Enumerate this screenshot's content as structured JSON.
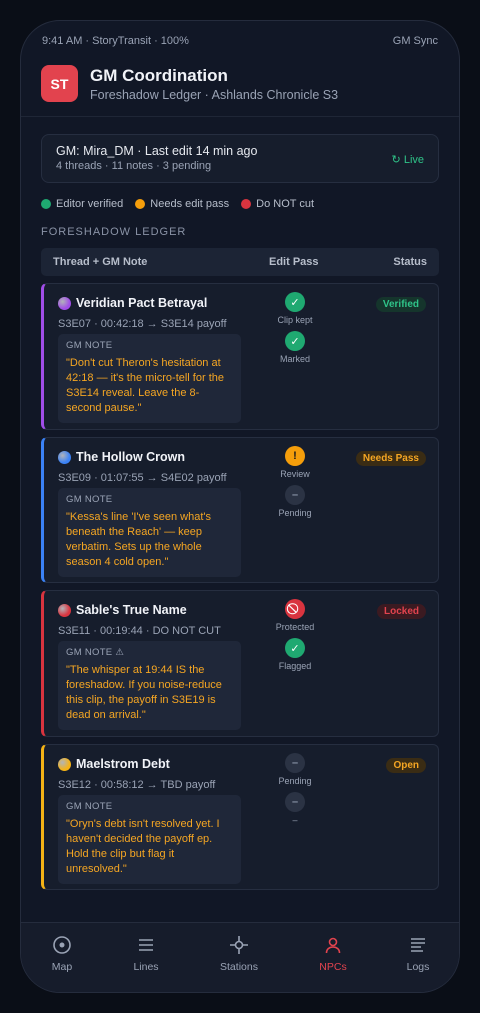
{
  "status_bar": {
    "left": "9:41 AM · StoryTransit · 100%",
    "right": "GM Sync"
  },
  "app": {
    "icon_text": "ST",
    "title": "GM Coordination",
    "subtitle": "Foreshadow Ledger · Ashlands Chronicle S3"
  },
  "gm_card": {
    "line": "GM: Mira_DM · Last edit 14 min ago",
    "counts": "4 threads · 11 notes · 3 pending",
    "live": "↻ Live"
  },
  "legend": [
    {
      "label": "Editor verified",
      "color": "#1fa971"
    },
    {
      "label": "Needs edit pass",
      "color": "#f59e0b"
    },
    {
      "label": "Do NOT cut",
      "color": "#d9343f"
    }
  ],
  "section_label": "FORESHADOW LEDGER",
  "table": {
    "col_thread": "Thread + GM Note",
    "col_pass": "Edit Pass",
    "col_status": "Status"
  },
  "rows": [
    {
      "title": "Veridian Pact Betrayal",
      "accent": "#a14ee8",
      "meta": "S3E07 · 00:42:18 → S3E14 payoff",
      "note_label": "GM NOTE",
      "note": "\"Don't cut Theron's hesitation at 42:18 — it's the micro-tell for the S3E14 reveal. Leave the 8-second pause.\"",
      "pass": [
        {
          "icon": "✓",
          "label": "Clip kept",
          "kind": "green"
        },
        {
          "icon": "✓",
          "label": "Marked",
          "kind": "green"
        }
      ],
      "badge": "Verified",
      "badge_color": "#2fc489",
      "badge_bg": "#15352c"
    },
    {
      "title": "The Hollow Crown",
      "accent": "#3b82f6",
      "meta": "S3E09 · 01:07:55 → S4E02 payoff",
      "note_label": "GM NOTE",
      "note": "\"Kessa's line 'I've seen what's beneath the Reach' — keep verbatim. Sets up the whole season 4 cold open.\"",
      "pass": [
        {
          "icon": "!",
          "label": "Review",
          "kind": "amber"
        },
        {
          "icon": "–",
          "label": "Pending",
          "kind": "grey"
        }
      ],
      "badge": "Needs Pass",
      "badge_color": "#f5a623",
      "badge_bg": "#3a2c14"
    },
    {
      "title": "Sable's True Name",
      "accent": "#d9343f",
      "meta": "S3E11 · 00:19:44 · DO NOT CUT",
      "note_label": "GM NOTE ⚠",
      "note": "\"The whisper at 19:44 IS the foreshadow. If you noise-reduce this clip, the payoff in S3E19 is dead on arrival.\"",
      "pass": [
        {
          "icon": "⃠",
          "label": "Protected",
          "kind": "red"
        },
        {
          "icon": "✓",
          "label": "Flagged",
          "kind": "green"
        }
      ],
      "badge": "Locked",
      "badge_color": "#e2434e",
      "badge_bg": "#3b1a21"
    },
    {
      "title": "Maelstrom Debt",
      "accent": "#f5b316",
      "meta": "S3E12 · 00:58:12 → TBD payoff",
      "note_label": "GM NOTE",
      "note": "\"Oryn's debt isn't resolved yet. I haven't decided the payoff ep. Hold the clip but flag it unresolved.\"",
      "pass": [
        {
          "icon": "–",
          "label": "Pending",
          "kind": "grey"
        },
        {
          "icon": "–",
          "label": "–",
          "kind": "grey"
        }
      ],
      "badge": "Open",
      "badge_color": "#f5a623",
      "badge_bg": "#3a2c14"
    }
  ],
  "tabs": [
    {
      "label": "Map",
      "icon": "map-icon"
    },
    {
      "label": "Lines",
      "icon": "lines-icon"
    },
    {
      "label": "Stations",
      "icon": "stations-icon"
    },
    {
      "label": "NPCs",
      "icon": "npc-icon",
      "active": true
    },
    {
      "label": "Logs",
      "icon": "logs-icon"
    }
  ]
}
